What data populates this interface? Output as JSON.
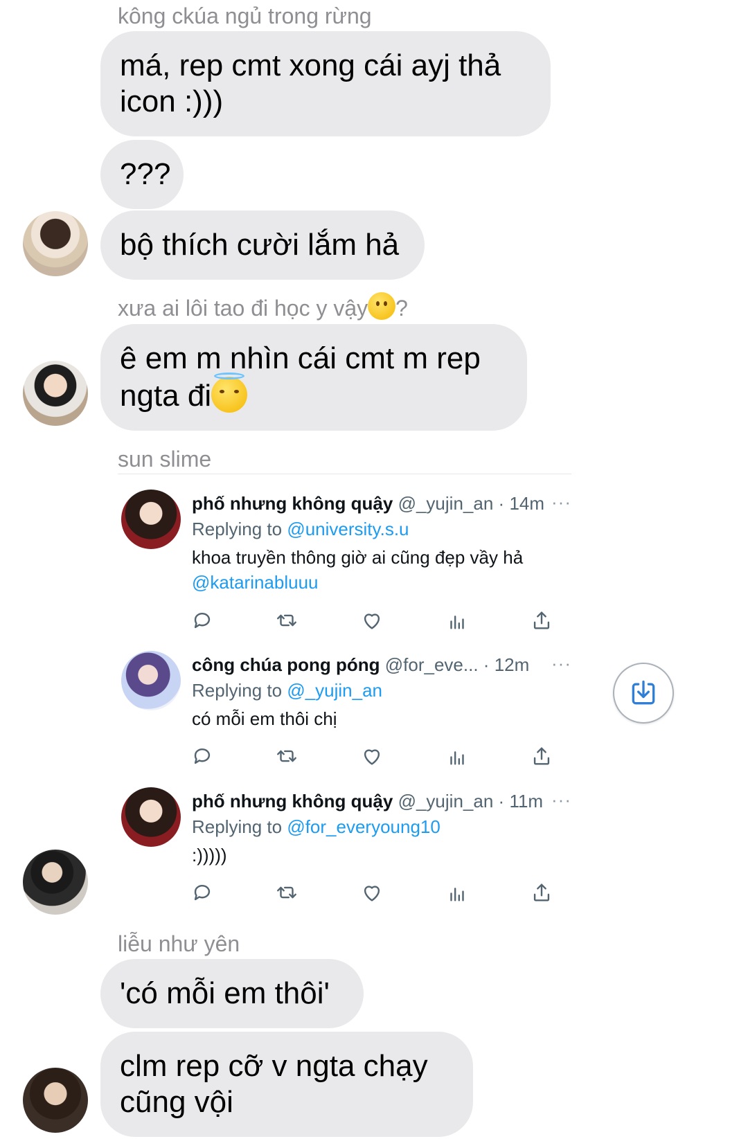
{
  "messages": [
    {
      "sender": "kông ckúa ngủ trong rừng",
      "bubbles": [
        "má, rep cmt xong cái ayj thả icon :)))",
        "???",
        "bộ thích cười lắm hả"
      ]
    },
    {
      "sender": "xưa ai lôi tao đi học y vậy",
      "sender_suffix": "?",
      "bubbles": [
        "ê em m nhìn cái cmt m rep ngta đi"
      ]
    },
    {
      "sender": "sun slime"
    },
    {
      "sender": "liễu như yên",
      "bubbles": [
        "'có mỗi em thôi'",
        "clm rep cỡ v ngta chạy cũng vội"
      ]
    }
  ],
  "tweets": [
    {
      "name": "phố nhưng không quậy",
      "handle": "@_yujin_an",
      "dot": "·",
      "time": "14m",
      "more": "···",
      "replying_label": "Replying to",
      "replying_to": "@university.s.u",
      "text": "khoa truyền thông giờ ai cũng đẹp vầy hả",
      "text_mention": "@katarinabluuu"
    },
    {
      "name": "công chúa pong póng",
      "handle": "@for_eve...",
      "dot": "·",
      "time": "12m",
      "more": "···",
      "replying_label": "Replying to",
      "replying_to": "@_yujin_an",
      "text": "có mỗi em thôi chị"
    },
    {
      "name": "phố nhưng không quậy",
      "handle": "@_yujin_an",
      "dot": "·",
      "time": "11m",
      "more": "···",
      "replying_label": "Replying to",
      "replying_to": "@for_everyoung10",
      "text": ":)))))"
    }
  ],
  "icons": {
    "reply": "reply-icon",
    "retweet": "retweet-icon",
    "like": "heart-icon",
    "views": "views-icon",
    "share": "share-icon",
    "save": "download-icon",
    "emoji_smile": "slightly-smiling-face-emoji",
    "emoji_halo": "smiling-face-with-halo-emoji"
  },
  "colors": {
    "bubble": "#e9e9eb",
    "sender": "#8e8e93",
    "mention": "#1d9bf0",
    "tweet_meta": "#536471"
  }
}
